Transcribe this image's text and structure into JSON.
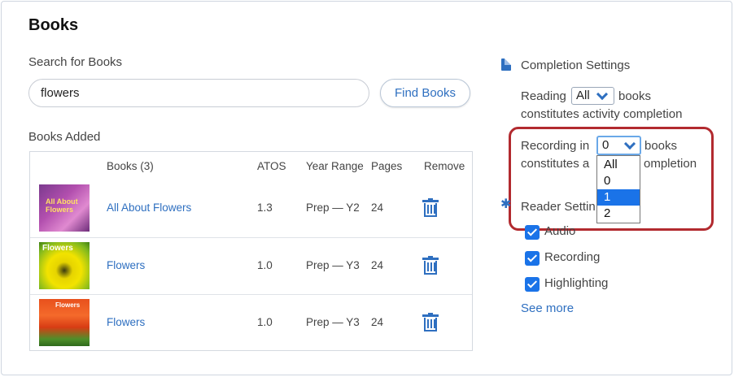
{
  "page": {
    "title": "Books"
  },
  "search": {
    "label": "Search for Books",
    "value": "flowers",
    "placeholder": "",
    "button": "Find Books"
  },
  "books_added": {
    "label": "Books Added",
    "columns": {
      "books": "Books (3)",
      "atos": "ATOS",
      "year_range": "Year Range",
      "pages": "Pages",
      "remove": "Remove"
    },
    "rows": [
      {
        "title": "All About Flowers",
        "atos": "1.3",
        "year_range": "Prep — Y2",
        "pages": "24",
        "cover_text": "All About Flowers"
      },
      {
        "title": "Flowers",
        "atos": "1.0",
        "year_range": "Prep — Y3",
        "pages": "24",
        "cover_text": "Flowers"
      },
      {
        "title": "Flowers",
        "atos": "1.0",
        "year_range": "Prep — Y3",
        "pages": "24",
        "cover_text": "Flowers"
      }
    ]
  },
  "completion": {
    "heading": "Completion Settings",
    "reading_prefix": "Reading",
    "reading_value": "All",
    "reading_suffix": "books",
    "reading_line2": "constitutes activity completion",
    "recording_prefix": "Recording in",
    "recording_value": "0",
    "recording_suffix": "books",
    "recording_line2_a": "constitutes a",
    "recording_line2_b": "ompletion",
    "dropdown_options": [
      "All",
      "0",
      "1",
      "2"
    ],
    "dropdown_highlighted": "1"
  },
  "reader": {
    "heading": "Reader Settin",
    "options": [
      {
        "label": "Audio",
        "checked": true
      },
      {
        "label": "Recording",
        "checked": true
      },
      {
        "label": "Highlighting",
        "checked": true
      }
    ],
    "see_more": "See more"
  },
  "colors": {
    "accent": "#2e6fc0",
    "checkbox": "#1a73e8",
    "highlight": "#b22a2f"
  }
}
